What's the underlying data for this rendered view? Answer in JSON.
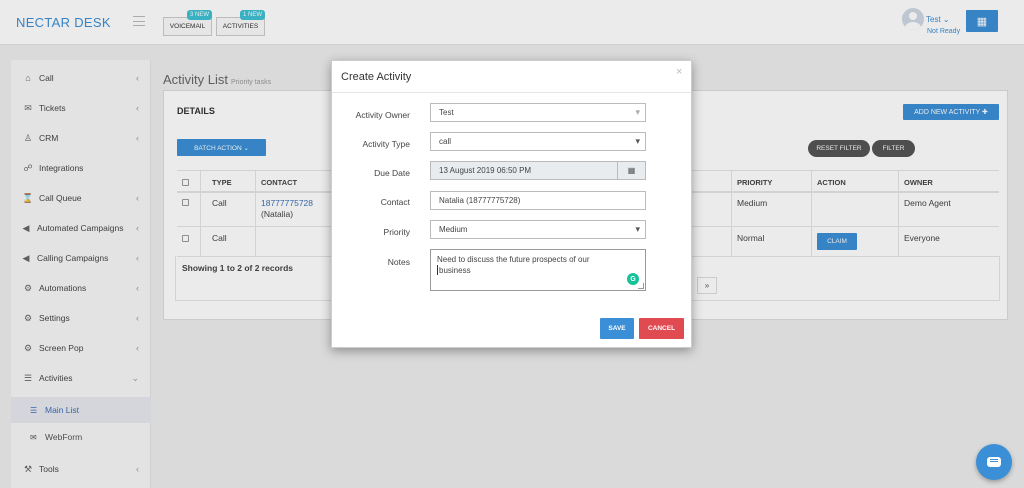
{
  "brand": "NECTAR DESK",
  "topbar": {
    "voicemail": {
      "label": "VOICEMAIL",
      "badge": "3 NEW"
    },
    "activities": {
      "label": "ACTIVITIES",
      "badge": "1 NEW"
    },
    "user": {
      "name": "Test",
      "status": "Not Ready"
    },
    "apps_icon": "grid-icon"
  },
  "sidebar": {
    "items": [
      {
        "label": "Call",
        "icon": "home-icon",
        "chevron": "‹"
      },
      {
        "label": "Tickets",
        "icon": "envelope-icon",
        "chevron": "‹"
      },
      {
        "label": "CRM",
        "icon": "user-icon",
        "chevron": "‹"
      },
      {
        "label": "Integrations",
        "icon": "handshake-icon",
        "chevron": ""
      },
      {
        "label": "Call Queue",
        "icon": "hourglass-icon",
        "chevron": "‹"
      },
      {
        "label": "Automated Campaigns",
        "icon": "megaphone-icon",
        "chevron": "‹"
      },
      {
        "label": "Calling Campaigns",
        "icon": "megaphone-icon",
        "chevron": "‹"
      },
      {
        "label": "Automations",
        "icon": "gear-icon",
        "chevron": "‹"
      },
      {
        "label": "Settings",
        "icon": "gear-icon",
        "chevron": "‹"
      },
      {
        "label": "Screen Pop",
        "icon": "gear-icon",
        "chevron": "‹"
      },
      {
        "label": "Activities",
        "icon": "list-icon",
        "chevron": "⌄"
      },
      {
        "label": "Tools",
        "icon": "wrench-icon",
        "chevron": "‹"
      }
    ],
    "sub_items": [
      {
        "label": "Main List",
        "icon": "list-icon"
      },
      {
        "label": "WebForm",
        "icon": "envelope-icon"
      }
    ]
  },
  "page": {
    "title": "Activity List",
    "subtitle": "Priority tasks",
    "details": "DETAILS",
    "add_activity": "ADD NEW ACTIVITY ✚",
    "batch_action": "BATCH ACTION ⌄",
    "reset_filter": "RESET FILTER",
    "filter": "FILTER",
    "columns": [
      "TYPE",
      "CONTACT",
      "PRIORITY",
      "ACTION",
      "OWNER"
    ],
    "rows": [
      {
        "type": "Call",
        "contact_number": "18777775728",
        "contact_name": "(Natalia)",
        "priority": "Medium",
        "action": "",
        "owner": "Demo Agent"
      },
      {
        "type": "Call",
        "contact_number": "",
        "contact_name": "",
        "priority": "Normal",
        "action": "CLAIM",
        "owner": "Everyone"
      }
    ],
    "showing": "Showing 1 to 2 of 2 records",
    "pager_next": "»"
  },
  "modal": {
    "title": "Create Activity",
    "close": "×",
    "fields": {
      "owner": {
        "label": "Activity Owner",
        "value": "Test"
      },
      "type": {
        "label": "Activity Type",
        "value": "call"
      },
      "due_date": {
        "label": "Due Date",
        "value": "13 August 2019 06:50 PM",
        "icon": "calendar-icon"
      },
      "contact": {
        "label": "Contact",
        "value": "Natalia  (18777775728)"
      },
      "priority": {
        "label": "Priority",
        "value": "Medium"
      },
      "notes": {
        "label": "Notes",
        "line1": "Need to discuss the future prospects of our",
        "line2": "business"
      }
    },
    "save": "SAVE",
    "cancel": "CANCEL"
  },
  "colors": {
    "primary": "#3b8fd6",
    "danger": "#e04b52",
    "badge": "#3ec1d3"
  }
}
